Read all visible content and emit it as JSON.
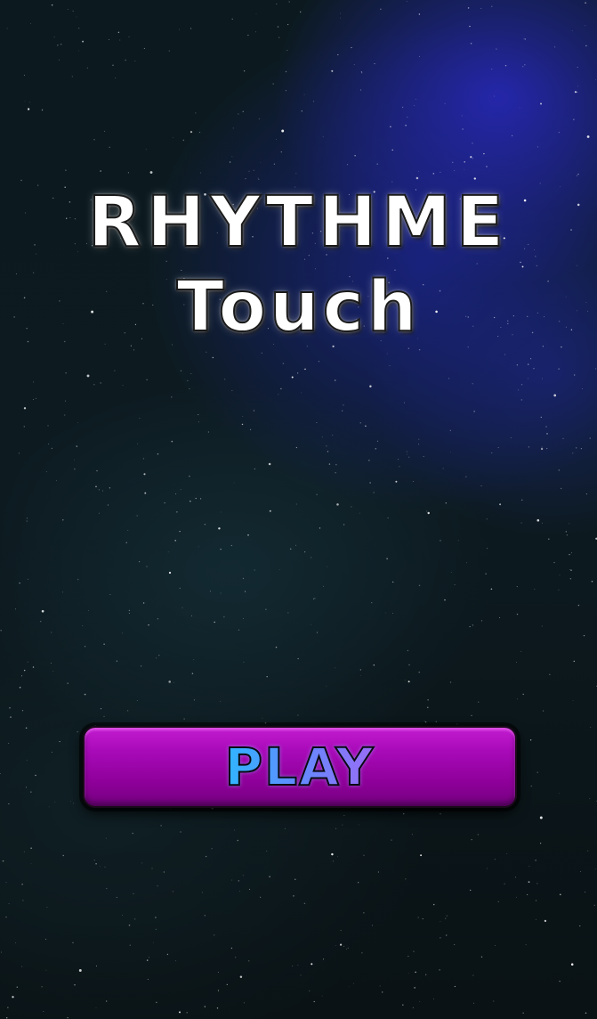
{
  "title": {
    "line1": "RHYTHME",
    "line2": "Touch"
  },
  "play_button": {
    "label": "PLAY"
  },
  "colors": {
    "button_purple": "#a80ab8",
    "label_blue": "#2fb6ff",
    "label_violet": "#9a6cf5",
    "nebula_blue": "#2828be",
    "background_dark": "#0c1a20"
  }
}
